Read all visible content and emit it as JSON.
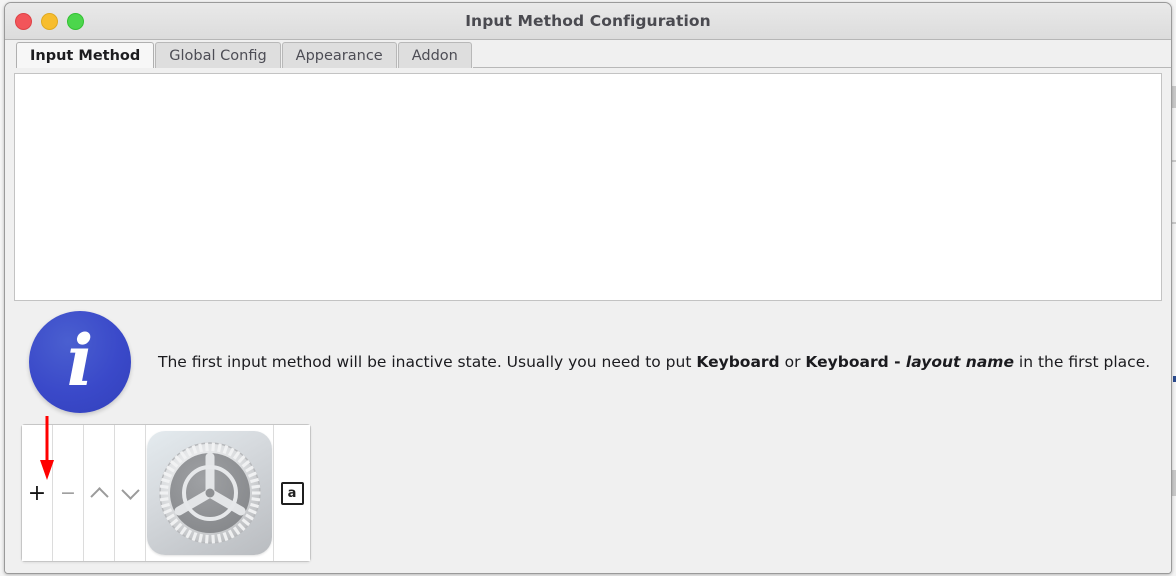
{
  "window": {
    "title": "Input Method Configuration",
    "controls": [
      {
        "name": "close",
        "color": "#f2555a"
      },
      {
        "name": "minimize",
        "color": "#f7bd2e"
      },
      {
        "name": "maximize",
        "color": "#4cd64c"
      }
    ]
  },
  "tabs": [
    {
      "label": "Input Method",
      "active": true
    },
    {
      "label": "Global Config",
      "active": false
    },
    {
      "label": "Appearance",
      "active": false
    },
    {
      "label": "Addon",
      "active": false
    }
  ],
  "input_method_list": {
    "items": [],
    "empty": ""
  },
  "hint": {
    "icon": "info-icon",
    "icon_glyph": "i",
    "icon_color": "#3a49c9",
    "text_part1": "The first input method will be inactive state. Usually you need to put ",
    "bold1": "Keyboard",
    "text_part2": " or ",
    "bold2": "Keyboard - ",
    "italic_bold": "layout name",
    "text_part3": " in the first place."
  },
  "toolbar": {
    "add_label": "+",
    "remove_label": "−",
    "move_up_label": "up-chevron",
    "move_down_label": "down-chevron",
    "configure_label": "gear-icon",
    "layout_label": "a"
  },
  "annotation": {
    "arrow_color": "#ff0000",
    "points_to": "add-button"
  }
}
